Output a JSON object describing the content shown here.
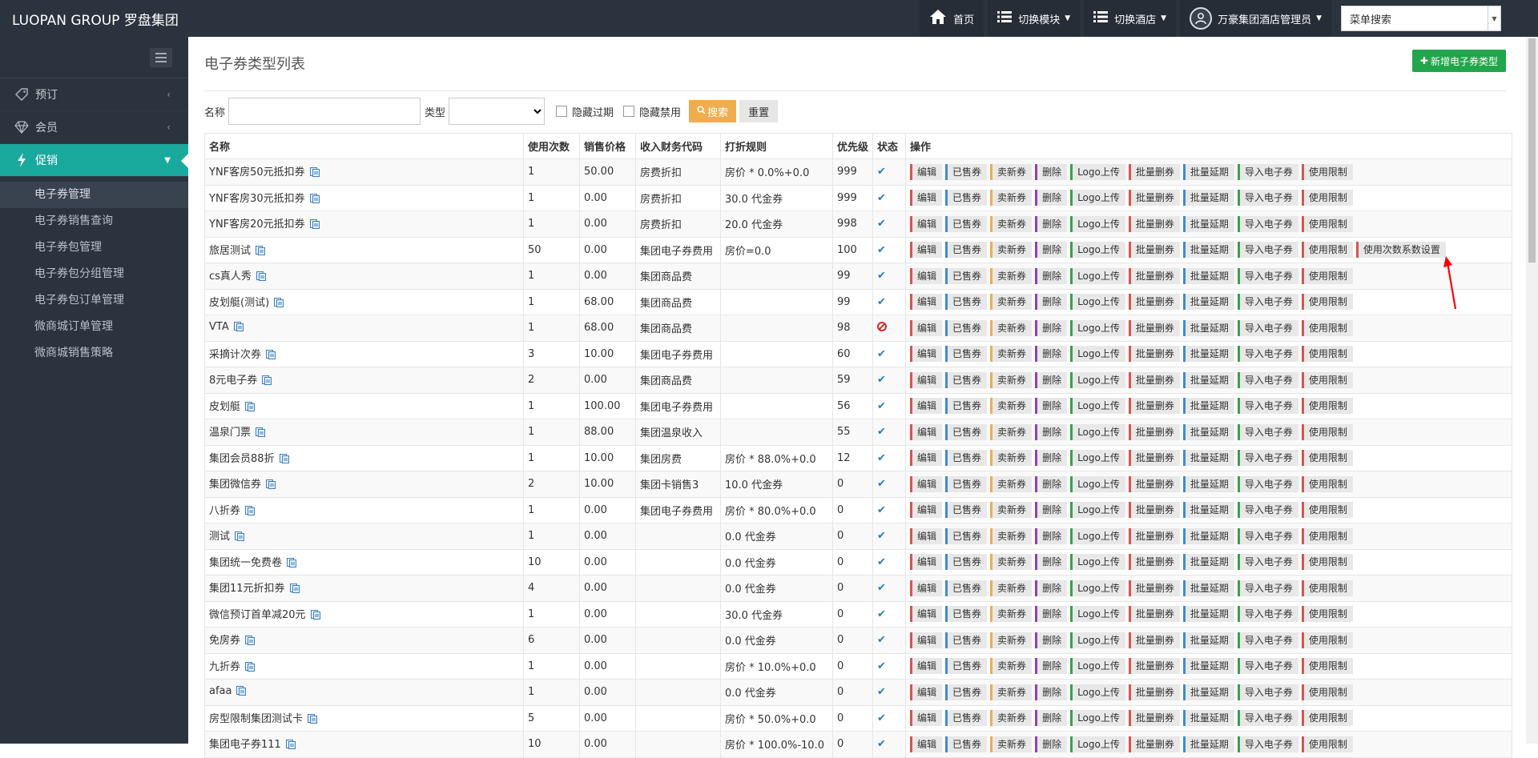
{
  "header": {
    "brand": "LUOPAN GROUP 罗盘集团",
    "home": "首页",
    "switch_module": "切换模块",
    "switch_hotel": "切换酒店",
    "user": "万豪集团酒店管理员",
    "menu_search": "菜单搜索"
  },
  "sidebar": {
    "menu": [
      {
        "label": "预订"
      },
      {
        "label": "会员"
      },
      {
        "label": "促销"
      }
    ],
    "submenu": [
      "电子券管理",
      "电子券销售查询",
      "电子券包管理",
      "电子券包分组管理",
      "电子券包订单管理",
      "微商城订单管理",
      "微商城销售策略"
    ]
  },
  "page": {
    "title": "电子券类型列表",
    "add_button": "新增电子券类型"
  },
  "filter": {
    "name_label": "名称",
    "type_label": "类型",
    "hide_expired": "隐藏过期",
    "hide_disabled": "隐藏禁用",
    "search_button": "搜索",
    "reset_button": "重置"
  },
  "table": {
    "headers": [
      "名称",
      "使用次数",
      "销售价格",
      "收入财务代码",
      "打折规则",
      "优先级",
      "状态",
      "操作"
    ],
    "actions": [
      "编辑",
      "已售券",
      "卖新券",
      "删除",
      "Logo上传",
      "批量删券",
      "批量延期",
      "导入电子券",
      "使用限制"
    ],
    "extra_action": "使用次数系数设置",
    "rows": [
      {
        "name": "YNF客房50元抵扣券",
        "uses": "1",
        "price": "50.00",
        "code": "房费折扣",
        "rule": "房价 * 0.0%+0.0",
        "priority": "999",
        "status": "ok"
      },
      {
        "name": "YNF客房30元抵扣券",
        "uses": "1",
        "price": "0.00",
        "code": "房费折扣",
        "rule": "30.0 代金券",
        "priority": "999",
        "status": "ok"
      },
      {
        "name": "YNF客房20元抵扣券",
        "uses": "1",
        "price": "0.00",
        "code": "房费折扣",
        "rule": "20.0 代金券",
        "priority": "998",
        "status": "ok"
      },
      {
        "name": "旅居测试",
        "uses": "50",
        "price": "0.00",
        "code": "集团电子券费用",
        "rule": "房价=0.0",
        "priority": "100",
        "status": "ok",
        "extra": true
      },
      {
        "name": "cs真人秀",
        "uses": "1",
        "price": "0.00",
        "code": "集团商品费",
        "rule": "",
        "priority": "99",
        "status": "ok"
      },
      {
        "name": "皮划艇(测试)",
        "uses": "1",
        "price": "68.00",
        "code": "集团商品费",
        "rule": "",
        "priority": "99",
        "status": "ok"
      },
      {
        "name": "VTA",
        "uses": "1",
        "price": "68.00",
        "code": "集团商品费",
        "rule": "",
        "priority": "98",
        "status": "disabled"
      },
      {
        "name": "采摘计次券",
        "uses": "3",
        "price": "10.00",
        "code": "集团电子券费用",
        "rule": "",
        "priority": "60",
        "status": "ok"
      },
      {
        "name": "8元电子券",
        "uses": "2",
        "price": "0.00",
        "code": "集团商品费",
        "rule": "",
        "priority": "59",
        "status": "ok"
      },
      {
        "name": "皮划艇",
        "uses": "1",
        "price": "100.00",
        "code": "集团电子券费用",
        "rule": "",
        "priority": "56",
        "status": "ok"
      },
      {
        "name": "温泉门票",
        "uses": "1",
        "price": "88.00",
        "code": "集团温泉收入",
        "rule": "",
        "priority": "55",
        "status": "ok"
      },
      {
        "name": "集团会员88折",
        "uses": "1",
        "price": "10.00",
        "code": "集团房费",
        "rule": "房价 * 88.0%+0.0",
        "priority": "12",
        "status": "ok"
      },
      {
        "name": "集团微信券",
        "uses": "2",
        "price": "10.00",
        "code": "集团卡销售3",
        "rule": "10.0 代金券",
        "priority": "0",
        "status": "ok"
      },
      {
        "name": "八折券",
        "uses": "1",
        "price": "0.00",
        "code": "集团电子券费用",
        "rule": "房价 * 80.0%+0.0",
        "priority": "0",
        "status": "ok"
      },
      {
        "name": "测试",
        "uses": "1",
        "price": "0.00",
        "code": "",
        "rule": "0.0 代金券",
        "priority": "0",
        "status": "ok"
      },
      {
        "name": "集团统一免费卷",
        "uses": "10",
        "price": "0.00",
        "code": "",
        "rule": "0.0 代金券",
        "priority": "0",
        "status": "ok"
      },
      {
        "name": "集团11元折扣券",
        "uses": "4",
        "price": "0.00",
        "code": "",
        "rule": "0.0 代金券",
        "priority": "0",
        "status": "ok"
      },
      {
        "name": "微信预订首单减20元",
        "uses": "1",
        "price": "0.00",
        "code": "",
        "rule": "30.0 代金券",
        "priority": "0",
        "status": "ok"
      },
      {
        "name": "免房券",
        "uses": "6",
        "price": "0.00",
        "code": "",
        "rule": "0.0 代金券",
        "priority": "0",
        "status": "ok"
      },
      {
        "name": "九折券",
        "uses": "1",
        "price": "0.00",
        "code": "",
        "rule": "房价 * 10.0%+0.0",
        "priority": "0",
        "status": "ok"
      },
      {
        "name": "afaa",
        "uses": "1",
        "price": "0.00",
        "code": "",
        "rule": "0.0 代金券",
        "priority": "0",
        "status": "ok"
      },
      {
        "name": "房型限制集团测试卡",
        "uses": "5",
        "price": "0.00",
        "code": "",
        "rule": "房价 * 50.0%+0.0",
        "priority": "0",
        "status": "ok"
      },
      {
        "name": "集团电子券111",
        "uses": "10",
        "price": "0.00",
        "code": "",
        "rule": "房价 * 100.0%-10.0",
        "priority": "0",
        "status": "ok"
      }
    ]
  },
  "colors": {
    "sidebar_bg": "#2b333e",
    "active_menu": "#1aa99d",
    "add_button": "#22a64b",
    "search_button": "#f0ad4e",
    "status_ok": "#2a7ab8",
    "status_disabled": "#d9262c",
    "annotation_arrow": "#ff0000"
  },
  "icons": {
    "home": "home-icon",
    "list": "list-icon",
    "user": "user-avatar-icon",
    "tag": "tag-icon",
    "diamond": "diamond-icon",
    "bolt": "bolt-icon",
    "row_doc": "document-icon",
    "check": "check-icon",
    "ban": "ban-icon"
  }
}
